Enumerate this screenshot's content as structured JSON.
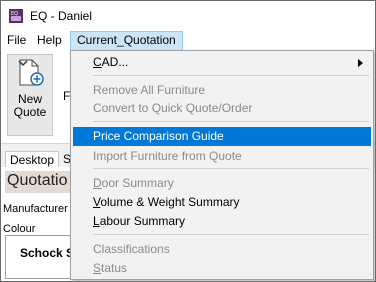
{
  "window": {
    "title": "EQ - Daniel"
  },
  "menubar": {
    "file": "File",
    "help": "Help",
    "current_quotation": "Current_Quotation"
  },
  "ribbon": {
    "new_quote_line1": "New",
    "new_quote_line2": "Quote",
    "partial_label": "F"
  },
  "tabs": {
    "desktop": "Desktop",
    "second": "S"
  },
  "content": {
    "heading": "Quotatio",
    "manufacturer_label": "Manufacturer",
    "colour_label": "Colour",
    "panel_title": "Schock S"
  },
  "menu": {
    "items": [
      {
        "key": "C",
        "rest": "AD...",
        "enabled": true,
        "submenu": true
      },
      {
        "key": "",
        "rest": "Remove All Furniture",
        "enabled": false
      },
      {
        "key": "",
        "rest": "Convert to Quick Quote/Order",
        "enabled": false
      },
      {
        "key": "",
        "rest": "Price Comparison Guide",
        "enabled": true,
        "highlighted": true
      },
      {
        "key": "",
        "rest": "Import Furniture from Quote",
        "enabled": false
      },
      {
        "key": "D",
        "rest": "oor Summary",
        "enabled": false
      },
      {
        "key": "V",
        "rest": "olume & Weight Summary",
        "enabled": true
      },
      {
        "key": "L",
        "rest": "abour Summary",
        "enabled": true
      },
      {
        "key": "",
        "rest": "Classifications",
        "enabled": false
      },
      {
        "key": "S",
        "rest": "tatus",
        "enabled": false
      }
    ]
  },
  "colors": {
    "highlight": "#0078d7",
    "menu_open": "#cce4f7",
    "disabled_text": "#8a8a8a",
    "quotation_bar": "#e3dbd3"
  }
}
